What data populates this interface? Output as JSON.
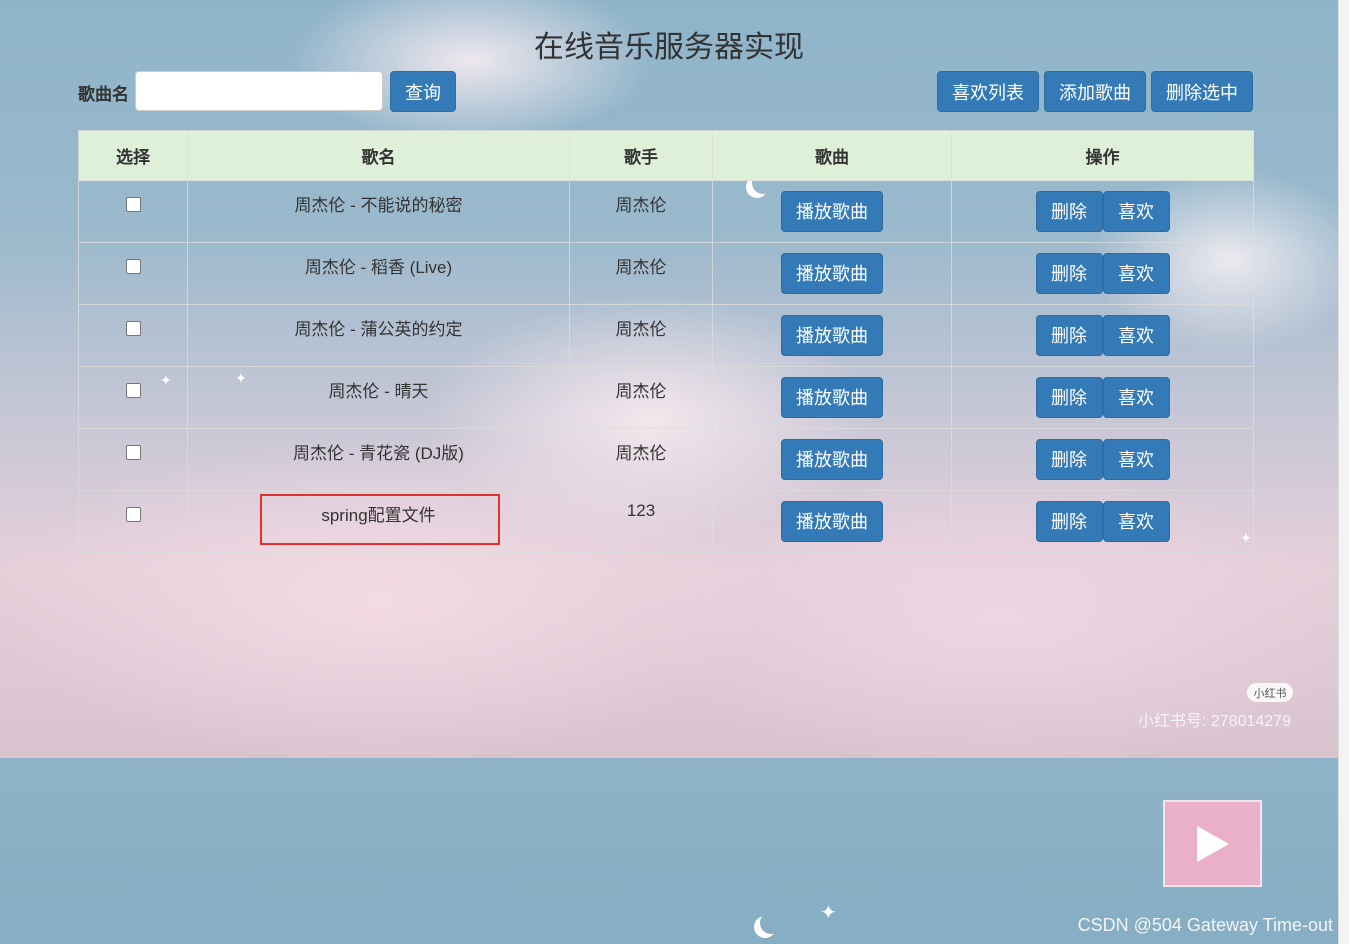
{
  "page_title": "在线音乐服务器实现",
  "search": {
    "label": "歌曲名",
    "value": "",
    "placeholder": "",
    "button": "查询"
  },
  "toolbar": {
    "like_list": "喜欢列表",
    "add_song": "添加歌曲",
    "delete_selected": "删除选中"
  },
  "table": {
    "headers": [
      "选择",
      "歌名",
      "歌手",
      "歌曲",
      "操作"
    ],
    "play_label": "播放歌曲",
    "delete_label": "删除",
    "like_label": "喜欢",
    "rows": [
      {
        "title": "周杰伦 - 不能说的秘密",
        "singer": "周杰伦",
        "checked": false
      },
      {
        "title": "周杰伦 - 稻香 (Live)",
        "singer": "周杰伦",
        "checked": false
      },
      {
        "title": "周杰伦 - 蒲公英的约定",
        "singer": "周杰伦",
        "checked": false
      },
      {
        "title": "周杰伦 - 晴天",
        "singer": "周杰伦",
        "checked": false
      },
      {
        "title": "周杰伦 - 青花瓷 (DJ版)",
        "singer": "周杰伦",
        "checked": false
      },
      {
        "title": "spring配置文件",
        "singer": "123",
        "checked": false
      }
    ]
  },
  "watermark": {
    "logo": "小红书",
    "id": "小红书号: 278014279"
  },
  "player": {
    "icon": "play-icon"
  },
  "footer_credit": "CSDN @504 Gateway Time-out",
  "colors": {
    "button": "#337ab7",
    "header_row": "#dff0d8",
    "highlight": "#e03030",
    "player": "#eab0c8"
  }
}
